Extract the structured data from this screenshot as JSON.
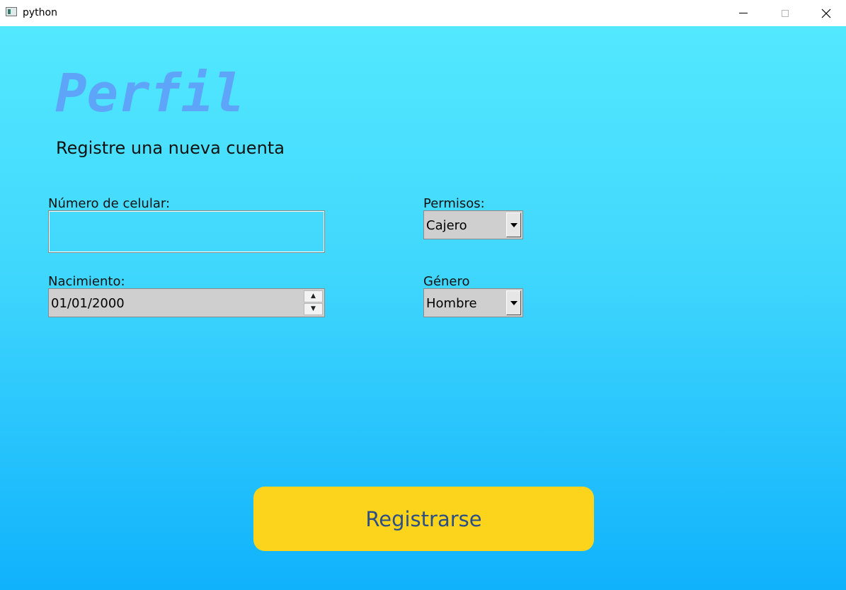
{
  "window": {
    "title": "python",
    "controls": {
      "minimize": "minimize-icon",
      "maximize": "maximize-icon",
      "close": "close-icon"
    }
  },
  "form": {
    "heading": "Perfil",
    "subheading": "Registre una nueva cuenta",
    "phone": {
      "label": "Número de celular:",
      "value": ""
    },
    "birth": {
      "label": "Nacimiento:",
      "value": "01/01/2000"
    },
    "permissions": {
      "label": "Permisos:",
      "selected": "Cajero"
    },
    "gender": {
      "label": "Género",
      "selected": "Hombre"
    },
    "submit_label": "Registrarse"
  },
  "colors": {
    "background_top": "#53e8fe",
    "background_bottom": "#10b2fc",
    "heading": "#5ea5fa",
    "button": "#fdd41c",
    "button_text": "#2c4f86"
  }
}
